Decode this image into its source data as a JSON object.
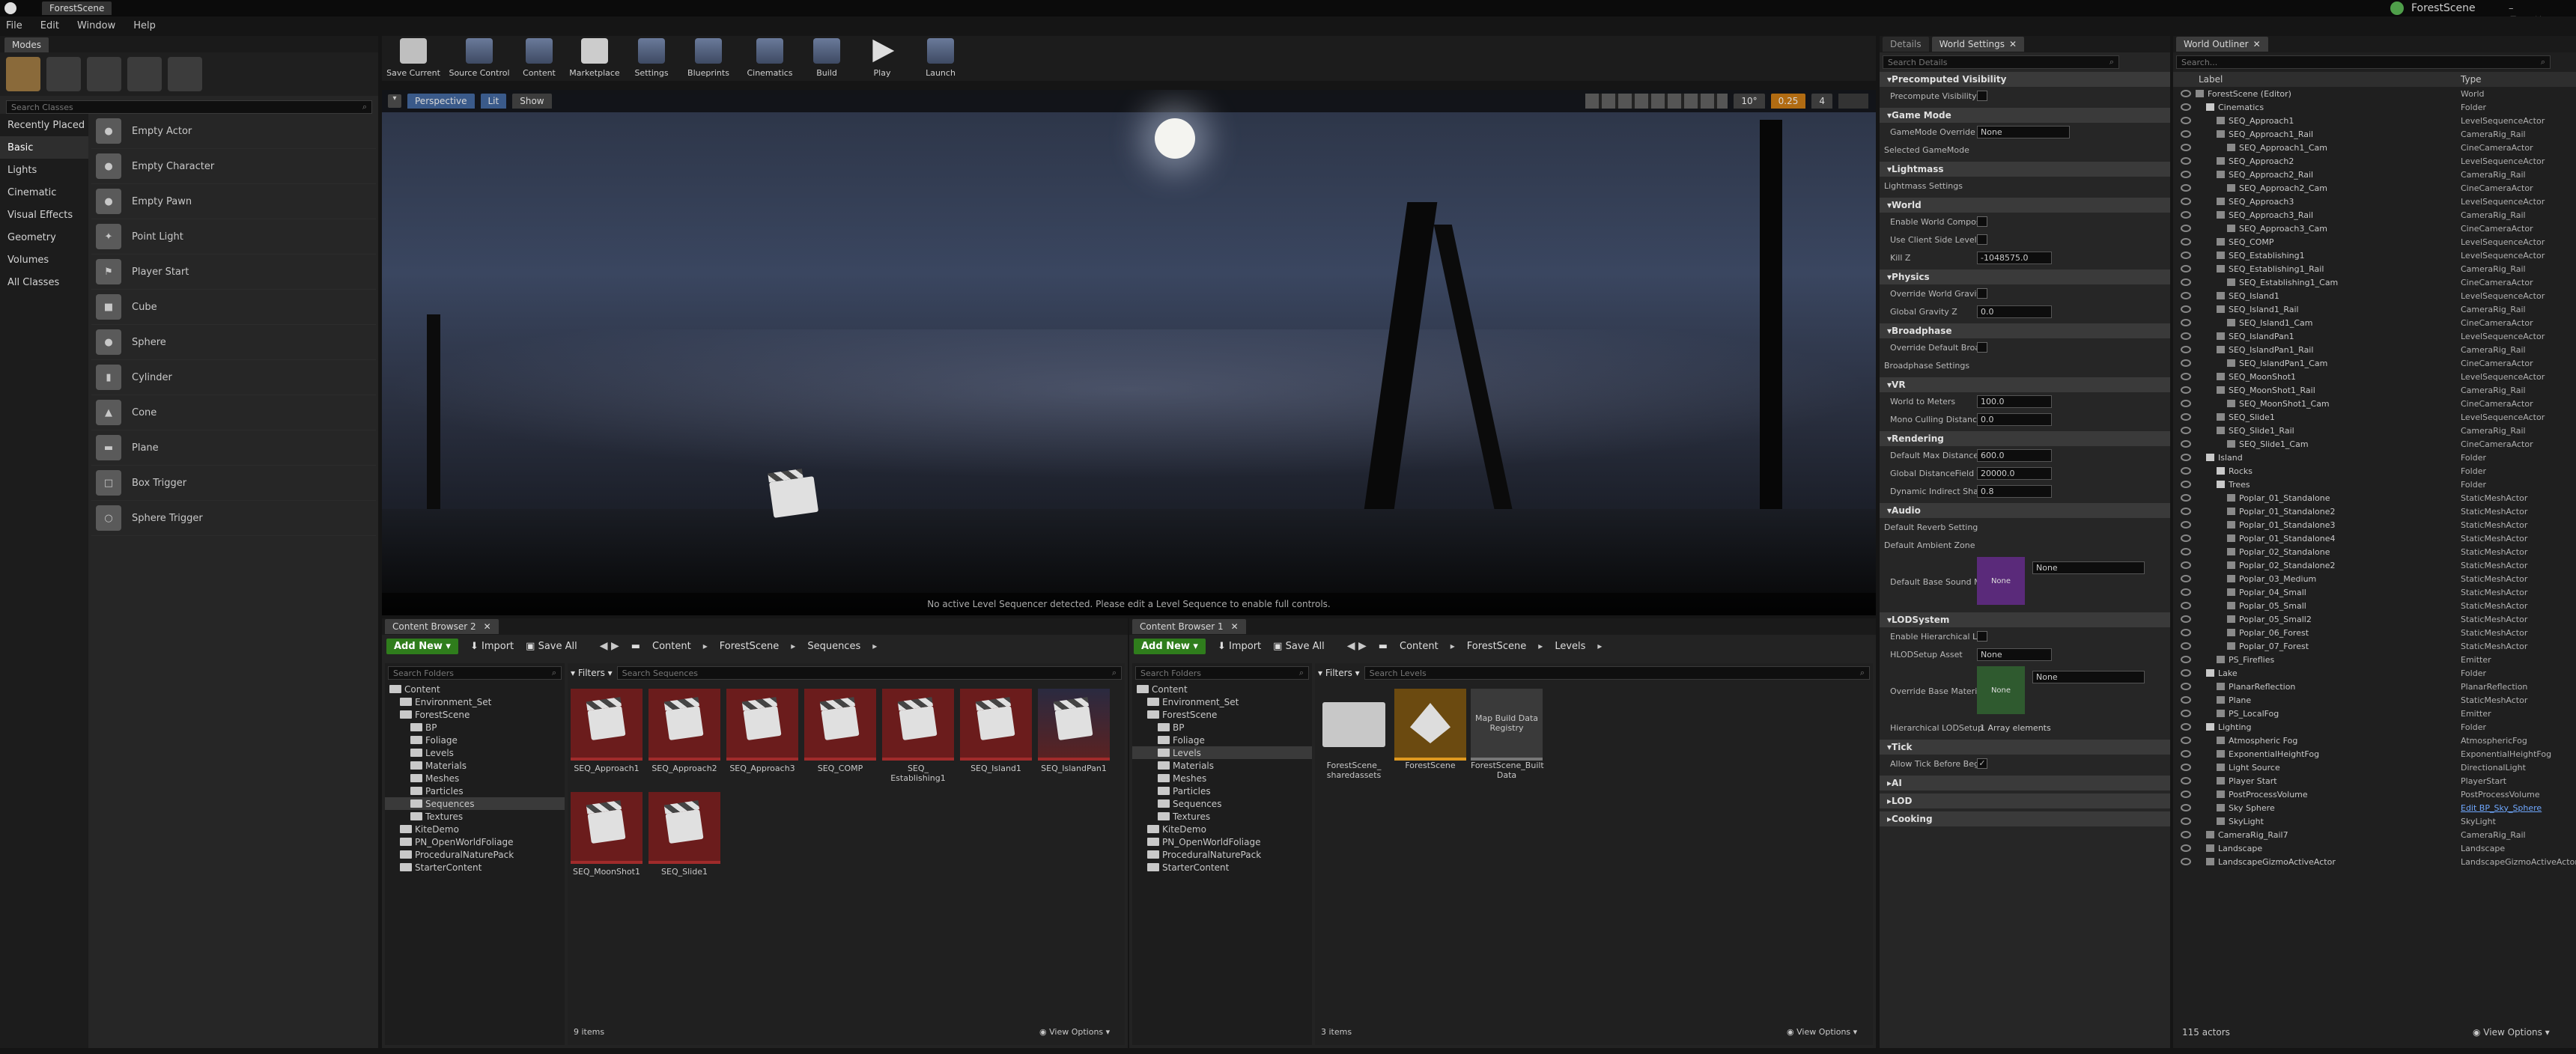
{
  "window": {
    "title": "ForestScene",
    "app_title": "ForestScene"
  },
  "menu": [
    "File",
    "Edit",
    "Window",
    "Help"
  ],
  "modes": {
    "tab": "Modes",
    "search_placeholder": "Search Classes",
    "categories": [
      "Recently Placed",
      "Basic",
      "Lights",
      "Cinematic",
      "Visual Effects",
      "Geometry",
      "Volumes",
      "All Classes"
    ],
    "selected_category": "Basic",
    "items": [
      "Empty Actor",
      "Empty Character",
      "Empty Pawn",
      "Point Light",
      "Player Start",
      "Cube",
      "Sphere",
      "Cylinder",
      "Cone",
      "Plane",
      "Box Trigger",
      "Sphere Trigger"
    ]
  },
  "toolbar": [
    "Save Current",
    "Source Control",
    "Content",
    "Marketplace",
    "Settings",
    "Blueprints",
    "Cinematics",
    "Build",
    "Play",
    "Launch"
  ],
  "viewport": {
    "perspective": "Perspective",
    "lit": "Lit",
    "show": "Show",
    "fov": "10°",
    "snap": "0.25",
    "grid": "4",
    "message": "No active Level Sequencer detected. Please edit a Level Sequence to enable full controls."
  },
  "cb2": {
    "tab": "Content Browser 2",
    "add_new": "Add New",
    "import": "Import",
    "save_all": "Save All",
    "path": [
      "Content",
      "ForestScene",
      "Sequences"
    ],
    "search_folders": "Search Folders",
    "filters": "Filters",
    "search_assets": "Search Sequences",
    "tree": [
      {
        "label": "Content",
        "depth": 0
      },
      {
        "label": "Environment_Set",
        "depth": 1
      },
      {
        "label": "ForestScene",
        "depth": 1
      },
      {
        "label": "BP",
        "depth": 2
      },
      {
        "label": "Foliage",
        "depth": 2
      },
      {
        "label": "Levels",
        "depth": 2
      },
      {
        "label": "Materials",
        "depth": 2
      },
      {
        "label": "Meshes",
        "depth": 2
      },
      {
        "label": "Particles",
        "depth": 2
      },
      {
        "label": "Sequences",
        "depth": 2
      },
      {
        "label": "Textures",
        "depth": 2
      },
      {
        "label": "KiteDemo",
        "depth": 1
      },
      {
        "label": "PN_OpenWorldFoliage",
        "depth": 1
      },
      {
        "label": "ProceduralNaturePack",
        "depth": 1
      },
      {
        "label": "StarterContent",
        "depth": 1
      }
    ],
    "selected_folder": "Sequences",
    "assets": [
      "SEQ_Approach1",
      "SEQ_Approach2",
      "SEQ_Approach3",
      "SEQ_COMP",
      "SEQ_ Establishing1",
      "SEQ_Island1",
      "SEQ_IslandPan1",
      "SEQ_MoonShot1",
      "SEQ_Slide1"
    ],
    "count": "9 items",
    "view_options": "View Options"
  },
  "cb1": {
    "tab": "Content Browser 1",
    "add_new": "Add New",
    "import": "Import",
    "save_all": "Save All",
    "path": [
      "Content",
      "ForestScene",
      "Levels"
    ],
    "search_folders": "Search Folders",
    "filters": "Filters",
    "search_assets": "Search Levels",
    "tree": [
      {
        "label": "Content",
        "depth": 0
      },
      {
        "label": "Environment_Set",
        "depth": 1
      },
      {
        "label": "ForestScene",
        "depth": 1
      },
      {
        "label": "BP",
        "depth": 2
      },
      {
        "label": "Foliage",
        "depth": 2
      },
      {
        "label": "Levels",
        "depth": 2
      },
      {
        "label": "Materials",
        "depth": 2
      },
      {
        "label": "Meshes",
        "depth": 2
      },
      {
        "label": "Particles",
        "depth": 2
      },
      {
        "label": "Sequences",
        "depth": 2
      },
      {
        "label": "Textures",
        "depth": 2
      },
      {
        "label": "KiteDemo",
        "depth": 1
      },
      {
        "label": "PN_OpenWorldFoliage",
        "depth": 1
      },
      {
        "label": "ProceduralNaturePack",
        "depth": 1
      },
      {
        "label": "StarterContent",
        "depth": 1
      }
    ],
    "selected_folder": "Levels",
    "assets": [
      "ForestScene_ sharedassets",
      "ForestScene",
      "ForestScene_Built Data"
    ],
    "thumb3_label": "Map Build Data Registry",
    "count": "3 items",
    "view_options": "View Options"
  },
  "details": {
    "tabs": [
      "Details",
      "World Settings"
    ],
    "search_placeholder": "Search Details",
    "sections": [
      {
        "title": "Precomputed Visibility",
        "props": [
          {
            "label": "Precompute Visibility",
            "kind": "check"
          }
        ]
      },
      {
        "title": "Game Mode",
        "props": [
          {
            "label": "GameMode Override",
            "kind": "combo",
            "value": "None"
          },
          {
            "label": "Selected GameMode",
            "kind": "expander"
          }
        ]
      },
      {
        "title": "Lightmass",
        "props": [
          {
            "label": "Lightmass Settings",
            "kind": "expander"
          }
        ]
      },
      {
        "title": "World",
        "props": [
          {
            "label": "Enable World Composi",
            "kind": "check"
          },
          {
            "label": "Use Client Side Level S",
            "kind": "check"
          },
          {
            "label": "Kill Z",
            "kind": "num",
            "value": "-1048575.0"
          }
        ]
      },
      {
        "title": "Physics",
        "props": [
          {
            "label": "Override World Gravity",
            "kind": "check"
          },
          {
            "label": "Global Gravity Z",
            "kind": "num",
            "value": "0.0"
          }
        ]
      },
      {
        "title": "Broadphase",
        "props": [
          {
            "label": "Override Default Broa",
            "kind": "check"
          },
          {
            "label": "Broadphase Settings",
            "kind": "expander"
          }
        ]
      },
      {
        "title": "VR",
        "props": [
          {
            "label": "World to Meters",
            "kind": "num",
            "value": "100.0"
          },
          {
            "label": "Mono Culling Distance",
            "kind": "num",
            "value": "0.0"
          }
        ]
      },
      {
        "title": "Rendering",
        "props": [
          {
            "label": "Default Max Distance",
            "kind": "num",
            "value": "600.0"
          },
          {
            "label": "Global DistanceField V",
            "kind": "num",
            "value": "20000.0"
          },
          {
            "label": "Dynamic Indirect Shad",
            "kind": "num",
            "value": "0.8"
          }
        ]
      },
      {
        "title": "Audio",
        "props": [
          {
            "label": "Default Reverb Setting",
            "kind": "expander"
          },
          {
            "label": "Default Ambient Zone",
            "kind": "expander"
          },
          {
            "label": "Default Base Sound M",
            "kind": "asset",
            "value": "None",
            "thumb": "None"
          }
        ]
      },
      {
        "title": "LODSystem",
        "props": [
          {
            "label": "Enable Hierarchical LC",
            "kind": "check"
          },
          {
            "label": "HLODSetup Asset",
            "kind": "combo",
            "value": "None"
          },
          {
            "label": "Override Base Materia",
            "kind": "asset",
            "value": "None",
            "thumb": "None"
          },
          {
            "label": "Hierarchical LODSetup",
            "kind": "array",
            "value": "1 Array elements"
          }
        ]
      },
      {
        "title": "Tick",
        "props": [
          {
            "label": "Allow Tick Before Beg",
            "kind": "checked"
          }
        ]
      },
      {
        "title": "AI",
        "props": []
      },
      {
        "title": "LOD",
        "props": []
      },
      {
        "title": "Cooking",
        "props": []
      }
    ]
  },
  "outliner": {
    "tab": "World Outliner",
    "search_placeholder": "Search...",
    "col_label": "Label",
    "col_type": "Type",
    "rows": [
      {
        "label": "ForestScene (Editor)",
        "type": "World",
        "depth": 0
      },
      {
        "label": "Cinematics",
        "type": "Folder",
        "depth": 1
      },
      {
        "label": "SEQ_Approach1",
        "type": "LevelSequenceActor",
        "depth": 2
      },
      {
        "label": "SEQ_Approach1_Rail",
        "type": "CameraRig_Rail",
        "depth": 2
      },
      {
        "label": "SEQ_Approach1_Cam",
        "type": "CineCameraActor",
        "depth": 3
      },
      {
        "label": "SEQ_Approach2",
        "type": "LevelSequenceActor",
        "depth": 2
      },
      {
        "label": "SEQ_Approach2_Rail",
        "type": "CameraRig_Rail",
        "depth": 2
      },
      {
        "label": "SEQ_Approach2_Cam",
        "type": "CineCameraActor",
        "depth": 3
      },
      {
        "label": "SEQ_Approach3",
        "type": "LevelSequenceActor",
        "depth": 2
      },
      {
        "label": "SEQ_Approach3_Rail",
        "type": "CameraRig_Rail",
        "depth": 2
      },
      {
        "label": "SEQ_Approach3_Cam",
        "type": "CineCameraActor",
        "depth": 3
      },
      {
        "label": "SEQ_COMP",
        "type": "LevelSequenceActor",
        "depth": 2
      },
      {
        "label": "SEQ_Establishing1",
        "type": "LevelSequenceActor",
        "depth": 2
      },
      {
        "label": "SEQ_Establishing1_Rail",
        "type": "CameraRig_Rail",
        "depth": 2
      },
      {
        "label": "SEQ_Establishing1_Cam",
        "type": "CineCameraActor",
        "depth": 3
      },
      {
        "label": "SEQ_Island1",
        "type": "LevelSequenceActor",
        "depth": 2
      },
      {
        "label": "SEQ_Island1_Rail",
        "type": "CameraRig_Rail",
        "depth": 2
      },
      {
        "label": "SEQ_Island1_Cam",
        "type": "CineCameraActor",
        "depth": 3
      },
      {
        "label": "SEQ_IslandPan1",
        "type": "LevelSequenceActor",
        "depth": 2
      },
      {
        "label": "SEQ_IslandPan1_Rail",
        "type": "CameraRig_Rail",
        "depth": 2
      },
      {
        "label": "SEQ_IslandPan1_Cam",
        "type": "CineCameraActor",
        "depth": 3
      },
      {
        "label": "SEQ_MoonShot1",
        "type": "LevelSequenceActor",
        "depth": 2
      },
      {
        "label": "SEQ_MoonShot1_Rail",
        "type": "CameraRig_Rail",
        "depth": 2
      },
      {
        "label": "SEQ_MoonShot1_Cam",
        "type": "CineCameraActor",
        "depth": 3
      },
      {
        "label": "SEQ_Slide1",
        "type": "LevelSequenceActor",
        "depth": 2
      },
      {
        "label": "SEQ_Slide1_Rail",
        "type": "CameraRig_Rail",
        "depth": 2
      },
      {
        "label": "SEQ_Slide1_Cam",
        "type": "CineCameraActor",
        "depth": 3
      },
      {
        "label": "Island",
        "type": "Folder",
        "depth": 1
      },
      {
        "label": "Rocks",
        "type": "Folder",
        "depth": 2
      },
      {
        "label": "Trees",
        "type": "Folder",
        "depth": 2
      },
      {
        "label": "Poplar_01_Standalone",
        "type": "StaticMeshActor",
        "depth": 3
      },
      {
        "label": "Poplar_01_Standalone2",
        "type": "StaticMeshActor",
        "depth": 3
      },
      {
        "label": "Poplar_01_Standalone3",
        "type": "StaticMeshActor",
        "depth": 3
      },
      {
        "label": "Poplar_01_Standalone4",
        "type": "StaticMeshActor",
        "depth": 3
      },
      {
        "label": "Poplar_02_Standalone",
        "type": "StaticMeshActor",
        "depth": 3
      },
      {
        "label": "Poplar_02_Standalone2",
        "type": "StaticMeshActor",
        "depth": 3
      },
      {
        "label": "Poplar_03_Medium",
        "type": "StaticMeshActor",
        "depth": 3
      },
      {
        "label": "Poplar_04_Small",
        "type": "StaticMeshActor",
        "depth": 3
      },
      {
        "label": "Poplar_05_Small",
        "type": "StaticMeshActor",
        "depth": 3
      },
      {
        "label": "Poplar_05_Small2",
        "type": "StaticMeshActor",
        "depth": 3
      },
      {
        "label": "Poplar_06_Forest",
        "type": "StaticMeshActor",
        "depth": 3
      },
      {
        "label": "Poplar_07_Forest",
        "type": "StaticMeshActor",
        "depth": 3
      },
      {
        "label": "PS_Fireflies",
        "type": "Emitter",
        "depth": 2
      },
      {
        "label": "Lake",
        "type": "Folder",
        "depth": 1
      },
      {
        "label": "PlanarReflection",
        "type": "PlanarReflection",
        "depth": 2
      },
      {
        "label": "Plane",
        "type": "StaticMeshActor",
        "depth": 2
      },
      {
        "label": "PS_LocalFog",
        "type": "Emitter",
        "depth": 2
      },
      {
        "label": "Lighting",
        "type": "Folder",
        "depth": 1
      },
      {
        "label": "Atmospheric Fog",
        "type": "AtmosphericFog",
        "depth": 2
      },
      {
        "label": "ExponentialHeightFog",
        "type": "ExponentialHeightFog",
        "depth": 2
      },
      {
        "label": "Light Source",
        "type": "DirectionalLight",
        "depth": 2
      },
      {
        "label": "Player Start",
        "type": "PlayerStart",
        "depth": 2
      },
      {
        "label": "PostProcessVolume",
        "type": "PostProcessVolume",
        "depth": 2
      },
      {
        "label": "Sky Sphere",
        "type": "Edit BP_Sky_Sphere",
        "depth": 2,
        "link": true
      },
      {
        "label": "SkyLight",
        "type": "SkyLight",
        "depth": 2
      },
      {
        "label": "CameraRig_Rail7",
        "type": "CameraRig_Rail",
        "depth": 1
      },
      {
        "label": "Landscape",
        "type": "Landscape",
        "depth": 1
      },
      {
        "label": "LandscapeGizmoActiveActor",
        "type": "LandscapeGizmoActiveActor",
        "depth": 1
      }
    ],
    "footer": "115 actors",
    "view_options": "View Options"
  }
}
